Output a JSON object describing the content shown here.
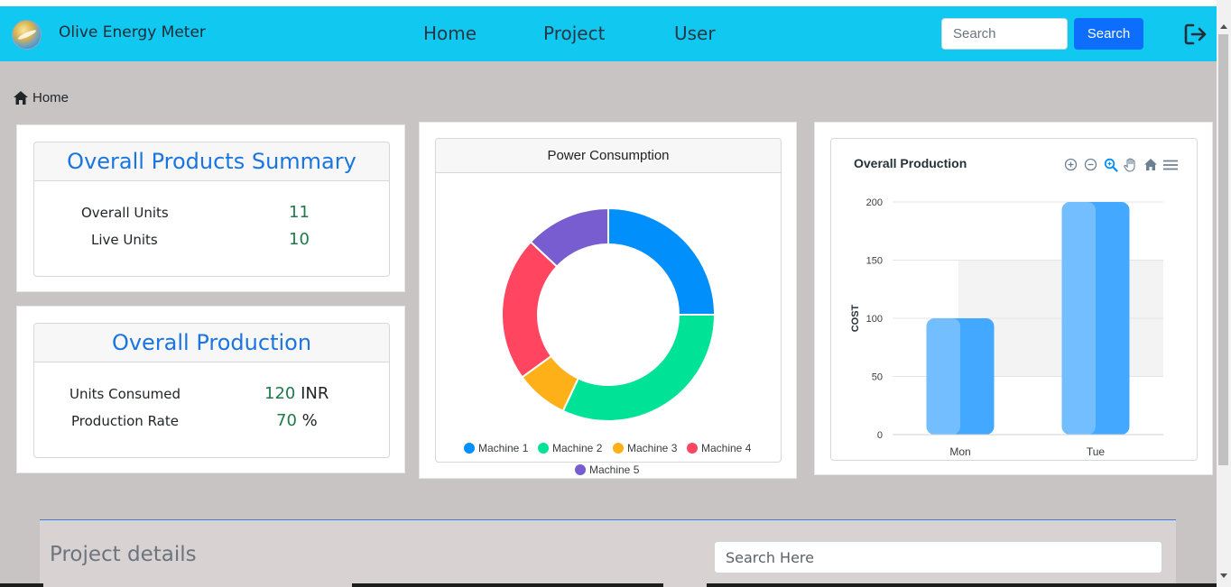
{
  "navbar": {
    "brand": "Olive Energy Meter",
    "links": [
      "Home",
      "Project",
      "User"
    ],
    "search_placeholder": "Search",
    "search_button": "Search",
    "logout_icon": "logout-icon",
    "logo_icon": "brand-logo"
  },
  "breadcrumb": {
    "icon": "home-icon",
    "label": "Home"
  },
  "summary": {
    "title": "Overall Products Summary",
    "rows": [
      {
        "label": "Overall Units",
        "value": "11"
      },
      {
        "label": "Live Units",
        "value": "10"
      }
    ]
  },
  "production": {
    "title": "Overall Production",
    "rows": [
      {
        "label": "Units Consumed",
        "value": "120",
        "unit": "INR"
      },
      {
        "label": "Production Rate",
        "value": "70",
        "unit": "%"
      }
    ]
  },
  "power_card": {
    "title": "Power Consumption"
  },
  "bar_card": {
    "title": "Overall Production",
    "toolbar": [
      "zoom-in-icon",
      "zoom-out-icon",
      "selection-zoom-icon",
      "pan-hand-icon",
      "reset-home-icon",
      "menu-icon"
    ]
  },
  "chart_data": [
    {
      "type": "pie",
      "title": "Power Consumption",
      "categories": [
        "Machine 1",
        "Machine 2",
        "Machine 3",
        "Machine 4",
        "Machine 5"
      ],
      "values": [
        25,
        32,
        8,
        22,
        13
      ],
      "colors": [
        "#008ffb",
        "#00e396",
        "#feb019",
        "#ff4560",
        "#775dd0"
      ],
      "donut": true,
      "legend": "bottom"
    },
    {
      "type": "bar",
      "title": "Overall Production",
      "categories": [
        "Mon",
        "Tue"
      ],
      "values": [
        100,
        200
      ],
      "ylabel": "COST",
      "xlabel": "",
      "ylim": [
        0,
        200
      ],
      "yticks": [
        0,
        50,
        100,
        150,
        200
      ],
      "grid": true,
      "color": "#43a8ff"
    }
  ],
  "project": {
    "title": "Project details",
    "search_placeholder": "Search Here"
  }
}
